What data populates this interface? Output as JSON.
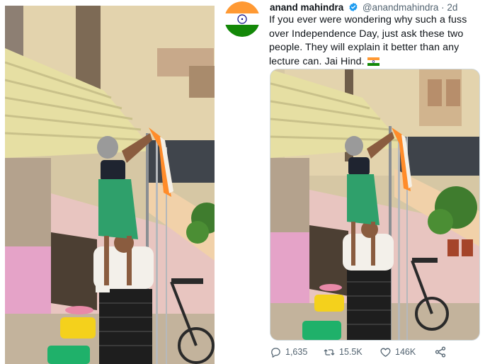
{
  "tweet": {
    "author_name": "anand mahindra",
    "handle": "@anandmahindra",
    "separator": "·",
    "time": "2d",
    "text": "If you ever were wondering why such a fuss over Independence Day, just ask these two people. They will explain it better than any lecture can. Jai Hind.",
    "avatar": "india-flag-avatar",
    "emoji": "india-flag-emoji"
  },
  "actions": {
    "replies": "1,635",
    "retweets": "15.5K",
    "likes": "146K",
    "share": "share-icon"
  },
  "colors": {
    "saffron": "#ff9933",
    "green": "#138808",
    "verified": "#1d9bf0",
    "muted": "#536471"
  }
}
